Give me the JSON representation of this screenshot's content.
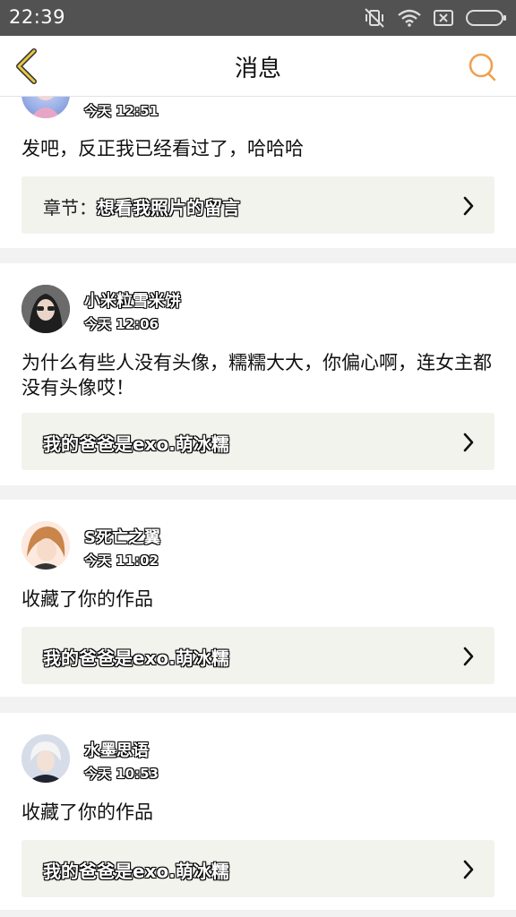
{
  "status_bar": {
    "time": "22:39"
  },
  "header": {
    "title": "消息"
  },
  "colors": {
    "accent": "#f0a050",
    "back_chevron": "#e8c840",
    "card_ref_bg": "#f3f3ee"
  },
  "cards": [
    {
      "time": "今天 12:51",
      "message": "发吧，反正我已经看过了，哈哈哈",
      "ref_prefix": "章节：",
      "ref_title": "想看我照片的留言"
    },
    {
      "username": "小米粒雪米饼",
      "time": "今天 12:06",
      "message": "为什么有些人没有头像，糯糯大大，你偏心啊，连女主都没有头像哎！",
      "ref_title": "我的爸爸是exo.萌冰糯"
    },
    {
      "username": "S死亡之翼",
      "time": "今天 11:02",
      "message": "收藏了你的作品",
      "ref_title": "我的爸爸是exo.萌冰糯"
    },
    {
      "username": "水墨思语",
      "time": "今天 10:53",
      "message": "收藏了你的作品",
      "ref_title": "我的爸爸是exo.萌冰糯"
    }
  ]
}
